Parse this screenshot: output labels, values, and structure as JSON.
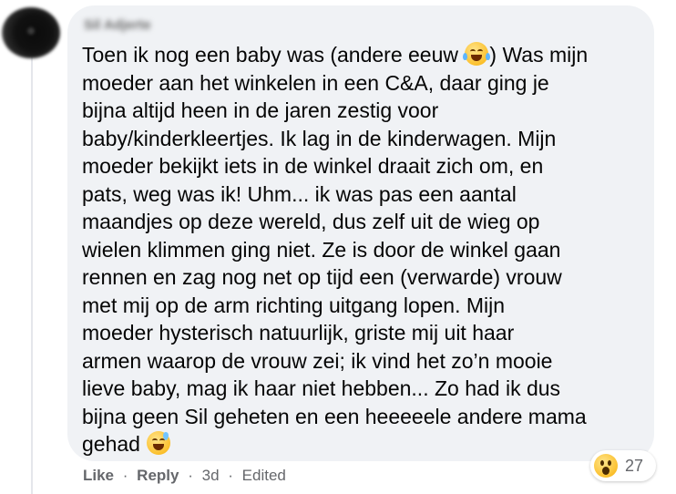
{
  "comment": {
    "author": "Sil Adjerte",
    "lines": [
      {
        "before": "Toen ik nog een baby was (andere eeuw ",
        "emoji": "face-with-tears-of-joy",
        "after": ") Was mijn"
      },
      {
        "before": "moeder aan het winkelen in een C&A, daar ging je"
      },
      {
        "before": "bijna altijd heen in de jaren zestig voor"
      },
      {
        "before": "baby/kinderkleertjes. Ik lag in de kinderwagen. Mijn"
      },
      {
        "before": "moeder bekijkt iets in de winkel draait zich om, en"
      },
      {
        "before": "pats, weg was ik! Uhm... ik was pas een aantal"
      },
      {
        "before": "maandjes op deze wereld, dus zelf uit de wieg op"
      },
      {
        "before": "wielen klimmen ging niet. Ze is door de winkel gaan"
      },
      {
        "before": "rennen en zag nog net op tijd een (verwarde) vrouw"
      },
      {
        "before": "met mij op de arm richting uitgang lopen. Mijn"
      },
      {
        "before": "moeder hysterisch natuurlijk, griste mij uit haar"
      },
      {
        "before": "armen waarop de vrouw zei; ik vind het zo’n mooie"
      },
      {
        "before": "lieve baby, mag ik haar niet hebben... Zo had ik dus"
      },
      {
        "before": "bijna geen Sil geheten en een heeeeele andere mama"
      },
      {
        "before": "gehad ",
        "emoji": "grinning-face-with-sweat"
      }
    ]
  },
  "actions": {
    "like": "Like",
    "reply": "Reply",
    "time": "3d",
    "edited": "Edited",
    "separator": "·"
  },
  "reactions": {
    "icon": "wow-reaction-icon",
    "count": "27"
  },
  "colors": {
    "bubble": "#f0f2f5",
    "text": "#050505",
    "meta": "#65676b"
  }
}
